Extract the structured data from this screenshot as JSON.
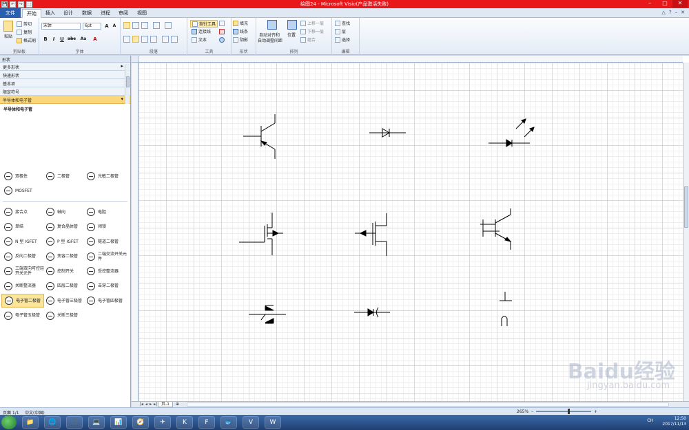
{
  "window": {
    "title": "绘图24  -  Microsoft Visio(产品激活失败)",
    "controls": [
      "–",
      "□",
      "✕"
    ]
  },
  "qat": [
    "💾",
    "↶",
    "↷",
    "⬚"
  ],
  "tabs": [
    {
      "label": "文件",
      "id": "file"
    },
    {
      "label": "开始",
      "id": "home"
    },
    {
      "label": "插入",
      "id": "insert"
    },
    {
      "label": "设计",
      "id": "design"
    },
    {
      "label": "数据",
      "id": "data"
    },
    {
      "label": "进程",
      "id": "process"
    },
    {
      "label": "审阅",
      "id": "review"
    },
    {
      "label": "视图",
      "id": "view"
    }
  ],
  "help": [
    "△",
    "?",
    "–",
    "✕"
  ],
  "ribbon": {
    "clipboard": {
      "label": "剪贴板",
      "paste": "粘贴",
      "cut": "剪切",
      "copy": "复制",
      "format_painter": "格式刷"
    },
    "font": {
      "label": "字体",
      "font_name": "宋体",
      "font_size": "6pt",
      "grow": "A",
      "shrink": "A",
      "bold": "B",
      "italic": "I",
      "underline": "U",
      "strike": "abc",
      "case": "Aa",
      "color": "A"
    },
    "paragraph": {
      "label": "段落"
    },
    "tools": {
      "label": "工具",
      "pointer": "指针工具",
      "connector": "连接线",
      "text": "文本"
    },
    "shape": {
      "label": "形状",
      "fill": "填充",
      "line": "线条",
      "shadow": "阴影"
    },
    "arrange": {
      "label": "排列",
      "auto_align": "自动对齐和",
      "auto_space": "自动调整间距",
      "position": "位置",
      "bring_forward": "上移一层",
      "send_backward": "下移一层",
      "group": "组合"
    },
    "editing": {
      "label": "编辑",
      "find": "查找",
      "layers": "层",
      "select": "选择"
    }
  },
  "shapes_pane": {
    "title": "形状",
    "stencils": [
      {
        "label": "更多形状",
        "chevron": "▸"
      },
      {
        "label": "快速形状",
        "chevron": ""
      },
      {
        "label": "基本项",
        "chevron": ""
      },
      {
        "label": "限定符号",
        "chevron": ""
      },
      {
        "label": "半导体和电子管",
        "chevron": "▾"
      }
    ],
    "section_title": "半导体和电子管",
    "masters_top": [
      {
        "label": "双极性",
        "sel": false
      },
      {
        "label": "二极管",
        "sel": false
      },
      {
        "label": "光敏二极管",
        "sel": false
      },
      {
        "label": "MOSFET",
        "sel": false
      }
    ],
    "masters": [
      {
        "label": "接合点",
        "sel": false
      },
      {
        "label": "轴向",
        "sel": false
      },
      {
        "label": "电阻",
        "sel": false
      },
      {
        "label": "单结",
        "sel": false
      },
      {
        "label": "复合晶体管",
        "sel": false
      },
      {
        "label": "闭锁",
        "sel": false
      },
      {
        "label": "N 型 IGFET",
        "sel": false
      },
      {
        "label": "P 型 IGFET",
        "sel": false
      },
      {
        "label": "隧道二极管",
        "sel": false
      },
      {
        "label": "反向二极管",
        "sel": false
      },
      {
        "label": "变容二极管",
        "sel": false
      },
      {
        "label": "二端交流开关元件",
        "sel": false
      },
      {
        "label": "三端双向可控硅开关元件",
        "sel": false
      },
      {
        "label": "控制开关",
        "sel": false
      },
      {
        "label": "受控整流器",
        "sel": false
      },
      {
        "label": "关断整流器",
        "sel": false
      },
      {
        "label": "四层二极管",
        "sel": false
      },
      {
        "label": "击穿二极管",
        "sel": false
      },
      {
        "label": "电子管二极管",
        "sel": true
      },
      {
        "label": "电子管三极管",
        "sel": false
      },
      {
        "label": "电子管四极管",
        "sel": false
      },
      {
        "label": "电子管五极管",
        "sel": false
      },
      {
        "label": "关断三极管",
        "sel": false
      }
    ]
  },
  "page": {
    "nav": [
      "|◂",
      "◂",
      "▸",
      "▸|"
    ],
    "tab": "页-1",
    "add": "⊕"
  },
  "status": {
    "page": "页面 1/1",
    "lang": "中文(中国)",
    "zoom": "265%"
  },
  "taskbar": {
    "icons": [
      "📁",
      "🌐",
      "🎵",
      "💻",
      "📊",
      "🧭",
      "✈",
      "K",
      "F",
      "🐟",
      "V",
      "W"
    ],
    "time": "12:50",
    "date": "2017/11/13",
    "lang": "CH"
  },
  "watermark": {
    "brand": "Baidu经验",
    "url": "jingyan.baidu.com"
  }
}
